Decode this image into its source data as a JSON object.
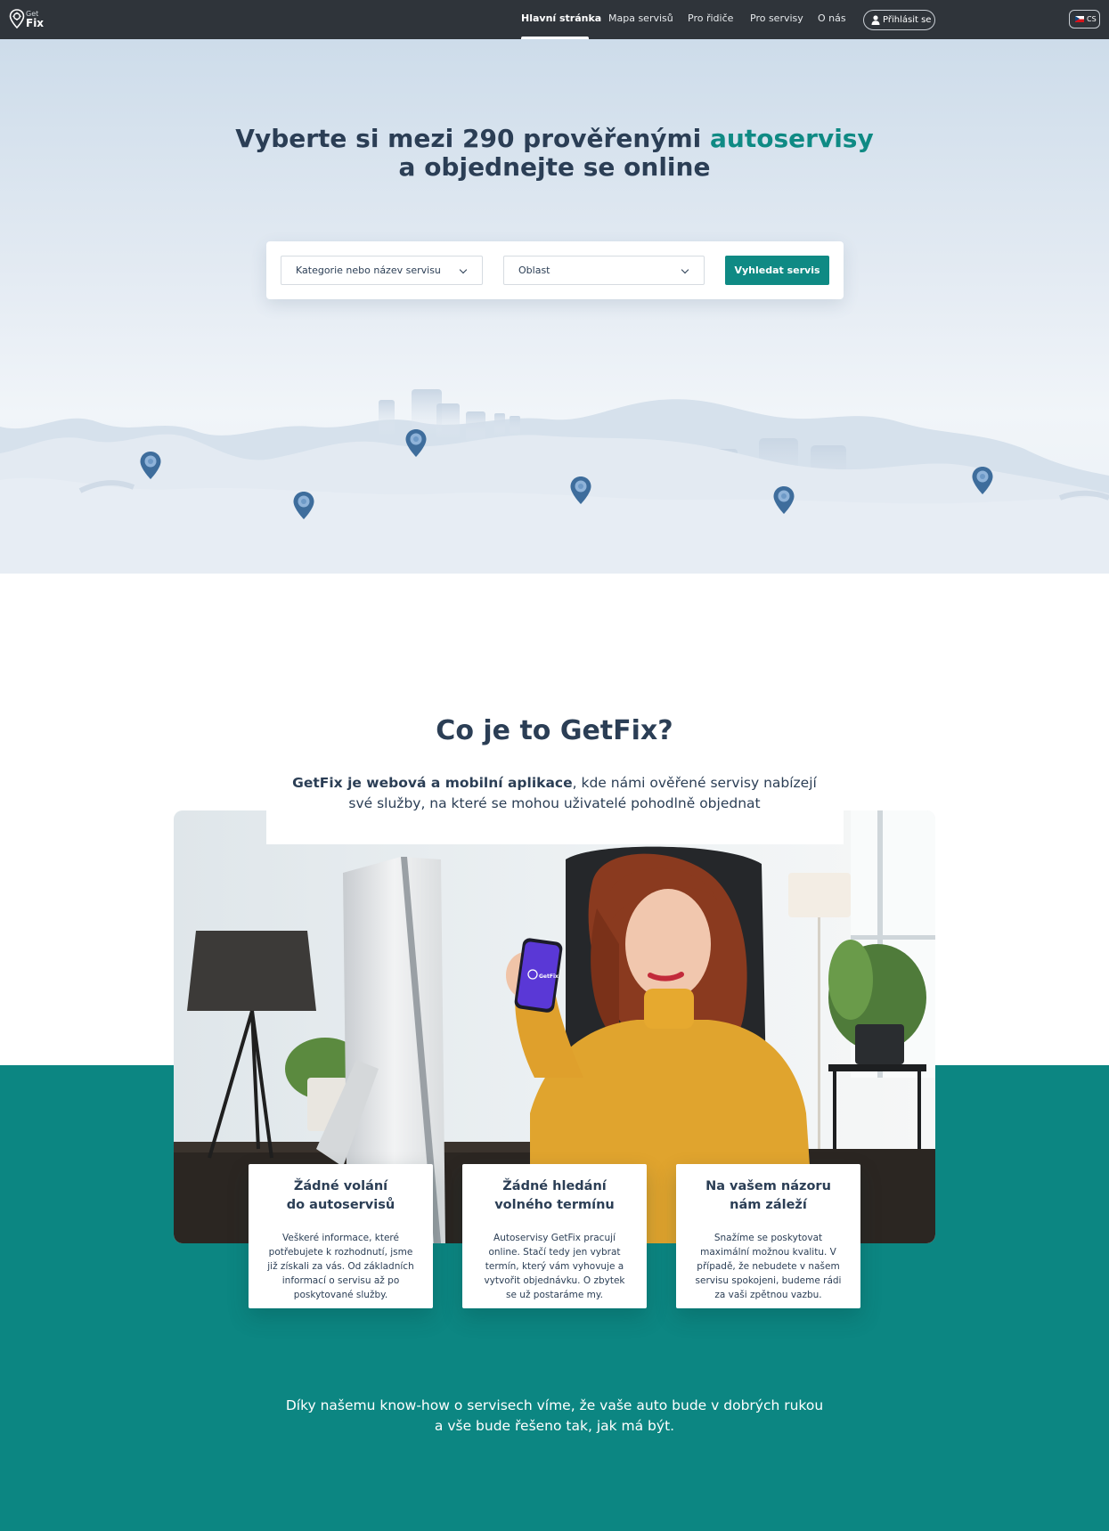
{
  "brand": {
    "logo_small": "Get",
    "logo_big": "Fix"
  },
  "nav": {
    "items": [
      {
        "label": "Hlavní stránka",
        "active": true
      },
      {
        "label": "Mapa servisů",
        "active": false
      },
      {
        "label": "Pro řidiče",
        "active": false
      },
      {
        "label": "Pro servisy",
        "active": false
      },
      {
        "label": "O nás",
        "active": false
      }
    ],
    "login_label": "Přihlásit se",
    "language": "CS"
  },
  "hero": {
    "title_line1_prefix": "Vyberte si mezi 290 prověřenými ",
    "title_line1_accent": "autoservisy",
    "title_line2": "a objednejte se online",
    "search": {
      "category_value": "Kategorie nebo název servisu",
      "area_value": "Oblast",
      "button_label": "Vyhledat servis"
    }
  },
  "about": {
    "title": "Co je to GetFix?",
    "lead_bold": "GetFix je webová a mobilní aplikace",
    "lead_rest": ", kde námi ověřené servisy nabízejí své služby, na které se mohou uživatelé pohodlně objednat",
    "phone_logo": "GetFix"
  },
  "features": [
    {
      "title": "Žádné volání\ndo autoservisů",
      "text": "Veškeré informace, které potřebujete k rozhodnutí, jsme již získali za vás. Od základních informací o servisu až po poskytované služby."
    },
    {
      "title": "Žádné hledání\nvolného termínu",
      "text": "Autoservisy GetFix pracují online. Stačí tedy jen vybrat termín, který vám vyhovuje a vytvořit objednávku. O zbytek se už postaráme my."
    },
    {
      "title": "Na vašem názoru\nnám záleží",
      "text": "Snažíme se poskytovat maximální možnou kvalitu. V případě, že nebudete v našem servisu spokojeni, budeme rádi za vaši zpětnou vazbu."
    }
  ],
  "bottom_text": "Díky našemu know-how o servisech víme, že vaše auto bude v dobrých rukou a vše bude řešeno tak, jak má být.",
  "colors": {
    "accent": "#0f8a84",
    "nav_bg": "#2f343a",
    "text": "#2b3e55",
    "band": "#0c8682"
  }
}
